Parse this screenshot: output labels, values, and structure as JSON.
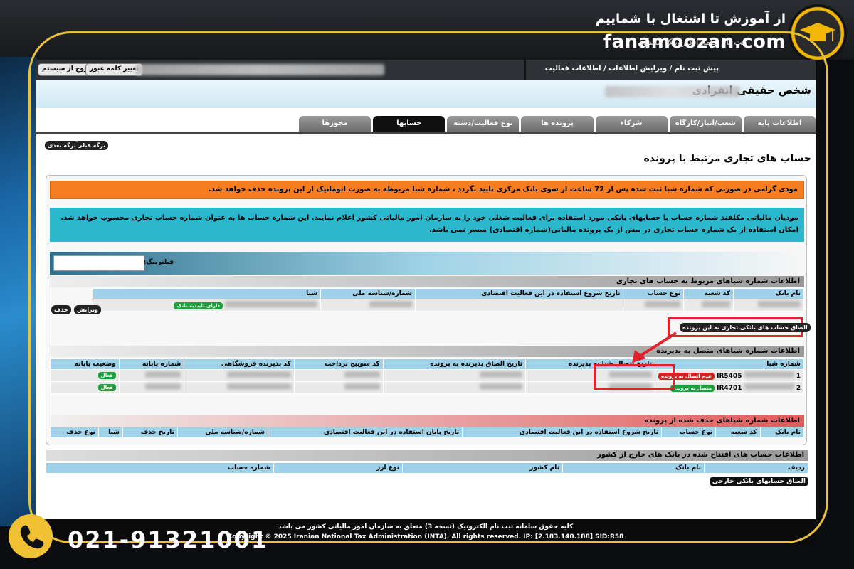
{
  "branding": {
    "site": "fanamoozan.com",
    "slogan": "از آموزش تا اشتغال با شماییم",
    "phone": "021-91321001",
    "gold": "#e9c13b"
  },
  "topbar": {
    "title": "ثبت نام جامع الکترونیک مالیاتی"
  },
  "header": {
    "change_password": "تغییر کلمه عبور",
    "logout": "خروج از سیستم",
    "breadcrumb": "پیش ثبت نام / ویرایش اطلاعات / اطلاعات فعالیت",
    "page_title": "شخص حقیقی انفرادی"
  },
  "tabs": [
    {
      "label": "اطلاعات پایه"
    },
    {
      "label": "شعب/انبار/کارگاه"
    },
    {
      "label": "شرکاء"
    },
    {
      "label": "پرونده ها"
    },
    {
      "label": "نوع فعالیت/دسته بندی"
    },
    {
      "label": "حسابها",
      "active": true
    },
    {
      "label": "مجوزها"
    }
  ],
  "pager": {
    "prev": "برگه قبلی",
    "next": "برگه بعدی"
  },
  "section_title": "حساب های تجاری مرتبط با پرونده",
  "alerts": {
    "orange": "مودی گرامی در صورتی که شماره شبا ثبت شده پس از 72 ساعت از سوی بانک مرکزی تایید نگردد ، شماره شبا مربوطه به صورت اتوماتیک از این پرونده حذف خواهد شد.",
    "cyan": "مودیان مالیاتی مکلفند شماره حساب یا حسابهای بانکی مورد استفاده برای فعالیت شغلی خود را به سازمان امور مالیاتی کشور اعلام نمایند. این شماره حساب ها به عنوان شماره حساب تجاری محسوب خواهد شد. امکان استفاده از یک شماره حساب تجاری در بیش از یک پرونده مالیاتی(شماره اقتصادی) میسر نمی باشد."
  },
  "filter": {
    "label": "فیلترینگ:",
    "value": ""
  },
  "linked_accounts": {
    "title": "اطلاعات شماره شباهای مربوط به حساب های تجاری",
    "columns": [
      "نام بانک",
      "کد شعبه",
      "نوع حساب",
      "تاریخ شروع استفاده در این فعالیت اقتصادی",
      "شماره/شناسه ملی",
      "شبا"
    ],
    "status_badge": "دارای تاییدیه بانک",
    "delete": "حذف",
    "edit": "ویرایش",
    "attach_button": "الصاق حساب های بانکی تجاری به این پرونده"
  },
  "acceptor": {
    "title": "اطلاعات شماره شباهای متصل به پذیرنده",
    "columns": [
      "شماره شبا",
      "تاریخ اتصال شبا به پذیرنده",
      "تاریخ الصاق پذیرنده به پرونده",
      "کد سوییچ پرداخت",
      "کد پذیرنده فروشگاهی",
      "شماره پایانه",
      "وضعیت پایانه"
    ],
    "rows": [
      {
        "index": "1",
        "sheba": "IR5405",
        "status": "عدم اتصال به پرونده",
        "state": "فعال"
      },
      {
        "index": "2",
        "sheba": "IR4701",
        "status": "متصل به پرونده",
        "state": "فعال"
      }
    ]
  },
  "deleted": {
    "title": "اطلاعات شماره شباهای حذف شده از پرونده",
    "columns": [
      "نام بانک",
      "کد شعبه",
      "نوع حساب",
      "تاریخ شروع استفاده در این فعالیت اقتصادی",
      "تاریخ پایان استفاده در این فعالیت اقتصادی",
      "شماره/شناسه ملی",
      "تاریخ حذف",
      "شبا",
      "نوع حذف"
    ]
  },
  "foreign": {
    "title": "اطلاعات حساب های افتتاح شده در بانک های خارج از کشور",
    "columns": [
      "ردیف",
      "نام بانک",
      "نام کشور",
      "نوع ارز",
      "شماره حساب"
    ],
    "attach": "الصاق حسابهای بانکی خارجی"
  },
  "footer": {
    "line1": "کلیه حقوق سامانه ثبت نام الکترونیک (نسخه 3) متعلق به سازمان امور مالیاتی کشور می باشد",
    "line2": "Copyright © 2025 Iranian National Tax Administration (INTA). All rights reserved. IP: [2.183.140.188] SID:R58"
  }
}
